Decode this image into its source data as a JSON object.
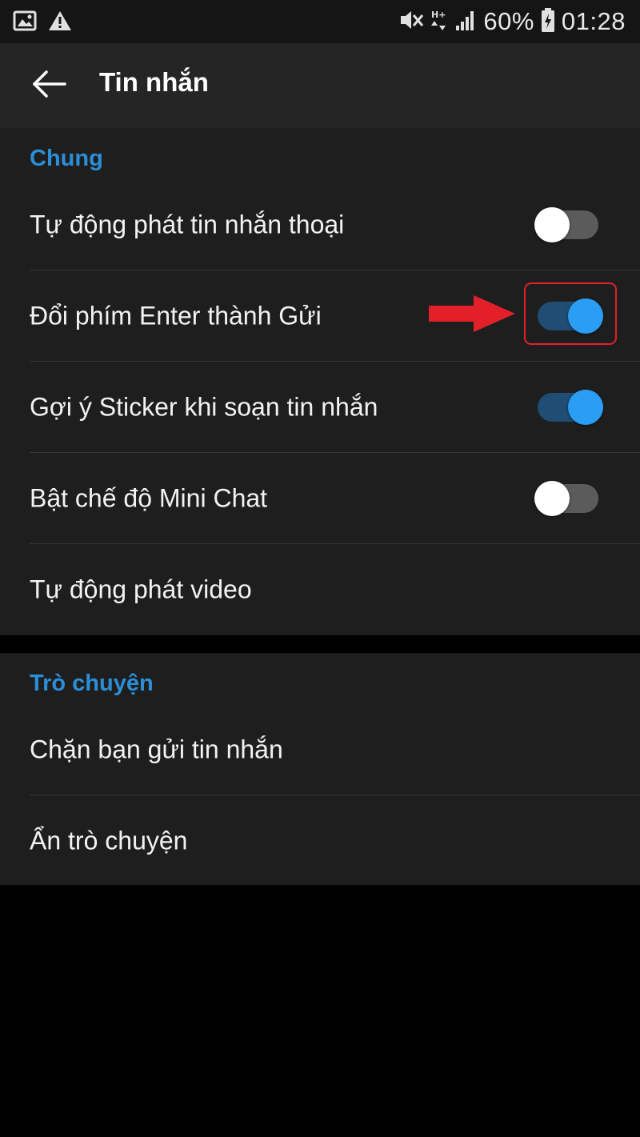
{
  "status_bar": {
    "battery": "60%",
    "time": "01:28",
    "icons": [
      "image-icon",
      "warning-icon",
      "mute-icon",
      "data-icon",
      "signal-icon",
      "battery-charging-icon"
    ]
  },
  "app_bar": {
    "title": "Tin nhắn",
    "back_icon": "back-arrow-icon"
  },
  "sections": [
    {
      "header": "Chung",
      "items": [
        {
          "label": "Tự động phát tin nhắn thoại",
          "toggle": false
        },
        {
          "label": "Đổi phím Enter thành Gửi",
          "toggle": true,
          "highlighted": true
        },
        {
          "label": "Gợi ý Sticker khi soạn tin nhắn",
          "toggle": true
        },
        {
          "label": "Bật chế độ Mini Chat",
          "toggle": false
        },
        {
          "label": "Tự động phát video"
        }
      ]
    },
    {
      "header": "Trò chuyện",
      "items": [
        {
          "label": "Chặn bạn gửi tin nhắn"
        },
        {
          "label": "Ẩn trò chuyện"
        }
      ]
    }
  ],
  "colors": {
    "accent": "#2a9df4",
    "section_header": "#2c8ed6",
    "annotation": "#e3202a",
    "background": "#1e1e1e"
  }
}
